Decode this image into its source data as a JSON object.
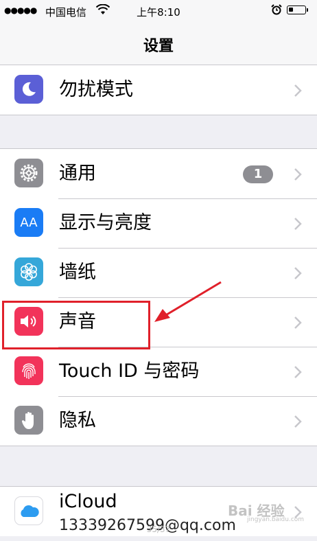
{
  "status_bar": {
    "signal": "●●●●●",
    "carrier": "中国电信",
    "time": "上午8:10",
    "battery_level": 0.3
  },
  "nav": {
    "title": "设置"
  },
  "groups": [
    {
      "items": [
        {
          "label": "勿扰模式",
          "icon": "moon-icon",
          "color": "#5b5fd6"
        }
      ]
    },
    {
      "items": [
        {
          "label": "通用",
          "icon": "gear-icon",
          "color": "#8e8e93",
          "badge": "1"
        },
        {
          "label": "显示与亮度",
          "icon": "text-size-icon",
          "color": "#1a7cf5"
        },
        {
          "label": "墙纸",
          "icon": "flower-icon",
          "color": "#35a7d9"
        },
        {
          "label": "声音",
          "icon": "speaker-icon",
          "color": "#f2335a"
        },
        {
          "label": "Touch ID 与密码",
          "icon": "fingerprint-icon",
          "color": "#f2335a"
        },
        {
          "label": "隐私",
          "icon": "hand-icon",
          "color": "#8e8e93"
        }
      ]
    },
    {
      "items": [
        {
          "label": "iCloud",
          "sublabel": "13339267599@qq.com",
          "icon": "cloud-icon",
          "color": "#ffffff"
        }
      ]
    }
  ],
  "text_size_glyph": "AA",
  "page_number": "35/37",
  "watermark": "Bai 经验",
  "watermark_sub": "jingyan.baidu.com",
  "colors": {
    "highlight": "#e0202a",
    "separator": "#c8c7cc",
    "background": "#efeff4"
  }
}
